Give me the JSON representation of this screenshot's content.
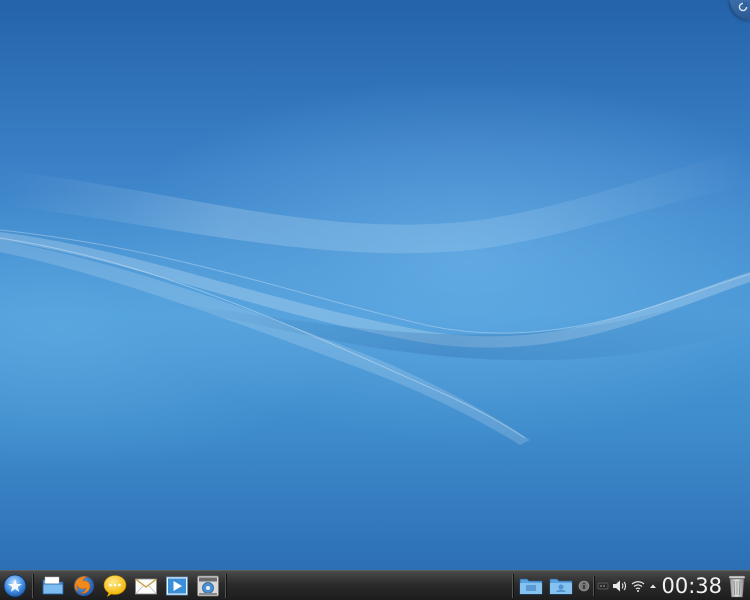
{
  "desktop": {
    "wallpaper": "blue-waves",
    "toolbox_icon": "cashew-icon"
  },
  "panel": {
    "launcher_icon": "kickoff-launcher-icon",
    "quick_launch": [
      {
        "name": "file-manager",
        "icon": "folder-icon"
      },
      {
        "name": "firefox",
        "icon": "firefox-icon"
      },
      {
        "name": "chat",
        "icon": "chat-bubble-icon"
      },
      {
        "name": "mail",
        "icon": "mail-icon"
      },
      {
        "name": "media-player",
        "icon": "play-icon"
      },
      {
        "name": "system-settings",
        "icon": "settings-icon"
      }
    ],
    "tray": {
      "items": [
        "folder-icon",
        "folder-user-icon",
        "info-icon",
        "small-status-icon",
        "volume-icon",
        "wifi-icon",
        "expand-arrow-icon"
      ],
      "clock": "00:38"
    },
    "trash_icon": "trash-icon"
  },
  "colors": {
    "panel_bg": "#262626",
    "wallpaper_top": "#2463aa",
    "wallpaper_mid": "#4a98d6",
    "clock_text": "#f2f2f2"
  }
}
